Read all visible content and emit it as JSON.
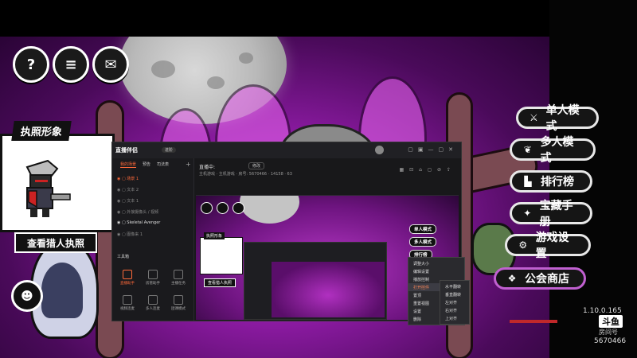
{
  "game": {
    "top_icons": [
      {
        "name": "help-icon",
        "glyph": "?"
      },
      {
        "name": "notes-icon",
        "glyph": "≡"
      },
      {
        "name": "mail-icon",
        "glyph": "✉"
      }
    ],
    "license_title": "执照形象",
    "view_license": "查看猎人执照",
    "menu": [
      {
        "id": "single",
        "label": "单人模式",
        "icon": "sword-icon",
        "glyph": "⚔"
      },
      {
        "id": "multi",
        "label": "多人模式",
        "icon": "wings-icon",
        "glyph": "❦"
      },
      {
        "id": "rank",
        "label": "排行榜",
        "icon": "podium-icon",
        "glyph": "▙"
      },
      {
        "id": "treasure",
        "label": "宝藏手册",
        "icon": "book-icon",
        "glyph": "✦"
      },
      {
        "id": "settings",
        "label": "游戏设置",
        "icon": "gear-icon",
        "glyph": "⚙"
      },
      {
        "id": "guild",
        "label": "公会商店",
        "icon": "guild-icon",
        "glyph": "❖"
      }
    ],
    "version": "1.10.0.165",
    "room_logo": "斗鱼",
    "room_label": "房间号",
    "room_id": "5670466",
    "accent": "#c060d0"
  },
  "stream_app": {
    "logo": "直播伴侣",
    "logo_badge": "进阶",
    "tabs": [
      "我的场景",
      "预告",
      "司法表"
    ],
    "scenes": [
      {
        "label": "场景 1",
        "selected": true
      },
      {
        "label": "文本 2",
        "selected": false
      },
      {
        "label": "文本 1",
        "selected": false
      },
      {
        "label": "外接摄像头 / 视频",
        "selected": false
      },
      {
        "label": "Skeletal Avenger",
        "selected": false
      },
      {
        "label": "图像来 1",
        "selected": false
      }
    ],
    "tools_title": "工具箱",
    "tools": [
      {
        "label": "直播助手",
        "hot": true
      },
      {
        "label": "房管助手",
        "hot": false
      },
      {
        "label": "主播任务",
        "hot": false
      },
      {
        "label": "视频连麦",
        "hot": false
      },
      {
        "label": "多人连麦",
        "hot": false
      },
      {
        "label": "团课模式",
        "hot": false
      }
    ],
    "status": "直播中:",
    "edit_btn": "修改",
    "tags": "主机游戏 · 主机游戏 · 房号: 5670466 · 14158 · 63",
    "preview": {
      "license_title": "执照形象",
      "view_license": "查看猎人执照",
      "menu": [
        "单人模式",
        "多人模式",
        "排行榜"
      ]
    },
    "context_menu": [
      "调整大小",
      "编辑设置",
      "播放控制",
      "打开控件",
      "置顶",
      "重置视图",
      "设置",
      "删除"
    ],
    "context_sub": [
      "水平翻转",
      "垂直翻转",
      "左对齐",
      "右对齐",
      "上对齐"
    ],
    "accent": "#ff6a3a"
  }
}
